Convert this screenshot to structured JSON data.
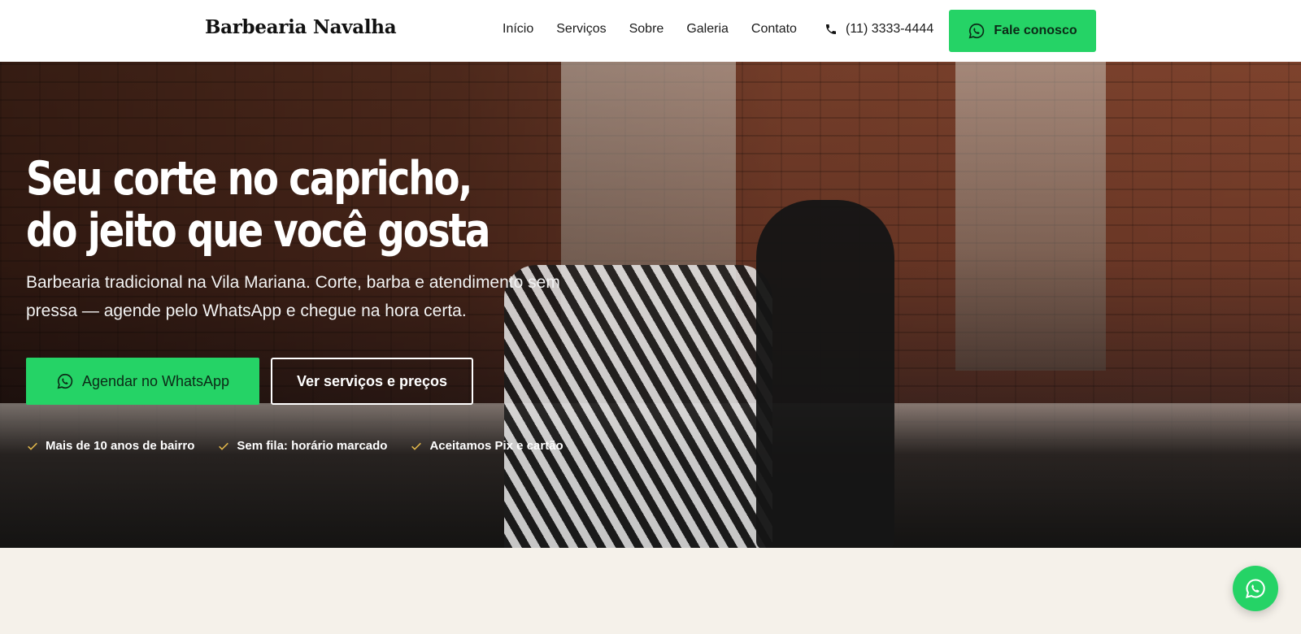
{
  "header": {
    "logo": "Barbearia Navalha",
    "nav": [
      "Início",
      "Serviços",
      "Sobre",
      "Galeria",
      "Contato"
    ],
    "phone": "(11) 3333-4444",
    "cta": "Fale conosco"
  },
  "hero": {
    "title_line1": "Seu corte no capricho,",
    "title_line2": "do jeito que você gosta",
    "subtitle": "Barbearia tradicional na Vila Mariana. Corte, barba e atendimento sem pressa — agende pelo WhatsApp e chegue na hora certa.",
    "primary_button": "Agendar no WhatsApp",
    "secondary_button": "Ver serviços e preços",
    "features": [
      "Mais de 10 anos de bairro",
      "Sem fila: horário marcado",
      "Aceitamos Pix e cartão"
    ]
  },
  "colors": {
    "whatsapp_green": "#25d366",
    "check_gold": "#e0b64a",
    "page_background": "#f5f1ea"
  },
  "icons": {
    "phone": "phone-icon",
    "whatsapp": "whatsapp-icon",
    "check": "check-icon"
  }
}
